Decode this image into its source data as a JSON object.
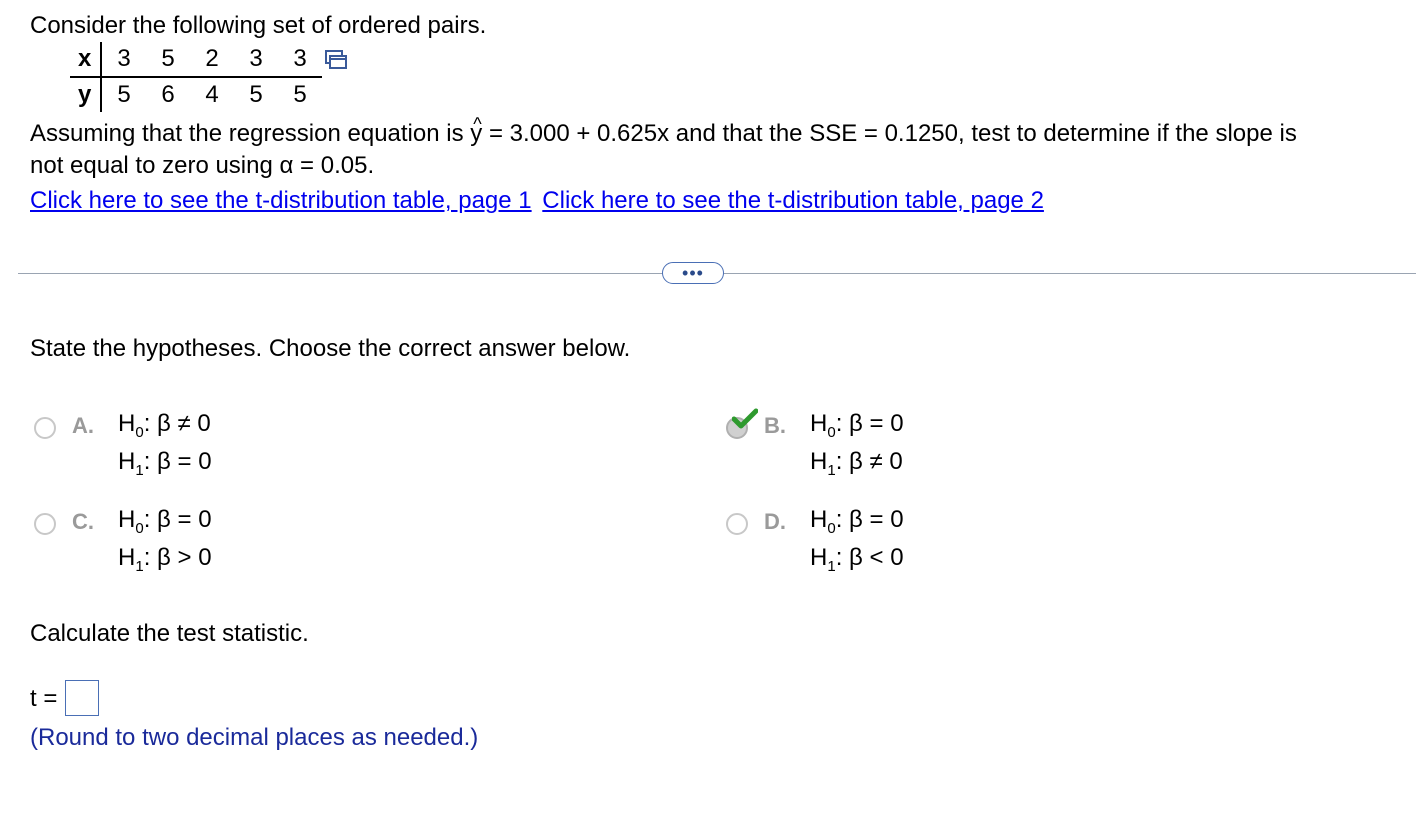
{
  "intro": "Consider the following set of ordered pairs.",
  "table": {
    "x_label": "x",
    "y_label": "y",
    "x_values": [
      "3",
      "5",
      "2",
      "3",
      "3"
    ],
    "y_values": [
      "5",
      "6",
      "4",
      "5",
      "5"
    ]
  },
  "question": {
    "part1": "Assuming that the regression equation is",
    "yhat": "y",
    "part2": "= 3.000 + 0.625x and that the SSE = 0.1250, test to determine if the slope is",
    "line2": "not equal to zero using α = 0.05."
  },
  "links": {
    "page1": "Click here to see the t-distribution table, page 1",
    "page2": "Click here to see the t-distribution table, page 2"
  },
  "more_button": "•••",
  "hypotheses_prompt": "State the hypotheses. Choose the correct answer below.",
  "choices": [
    {
      "letter": "A.",
      "h0": "β ≠ 0",
      "h1": "β = 0",
      "selected": false
    },
    {
      "letter": "B.",
      "h0": "β = 0",
      "h1": "β ≠ 0",
      "selected": true
    },
    {
      "letter": "C.",
      "h0": "β = 0",
      "h1": "β > 0",
      "selected": false
    },
    {
      "letter": "D.",
      "h0": "β = 0",
      "h1": "β < 0",
      "selected": false
    }
  ],
  "hyp_prefix": {
    "h": "H",
    "sub0": "0",
    "sub1": "1",
    "colon": ":"
  },
  "statistic_prompt": "Calculate the test statistic.",
  "t_label": "t =",
  "t_value": "",
  "round_note": "(Round to two decimal places as needed.)",
  "colors": {
    "link": "#0000ee",
    "check": "#2e9a2e",
    "note": "#1a2a9a"
  }
}
